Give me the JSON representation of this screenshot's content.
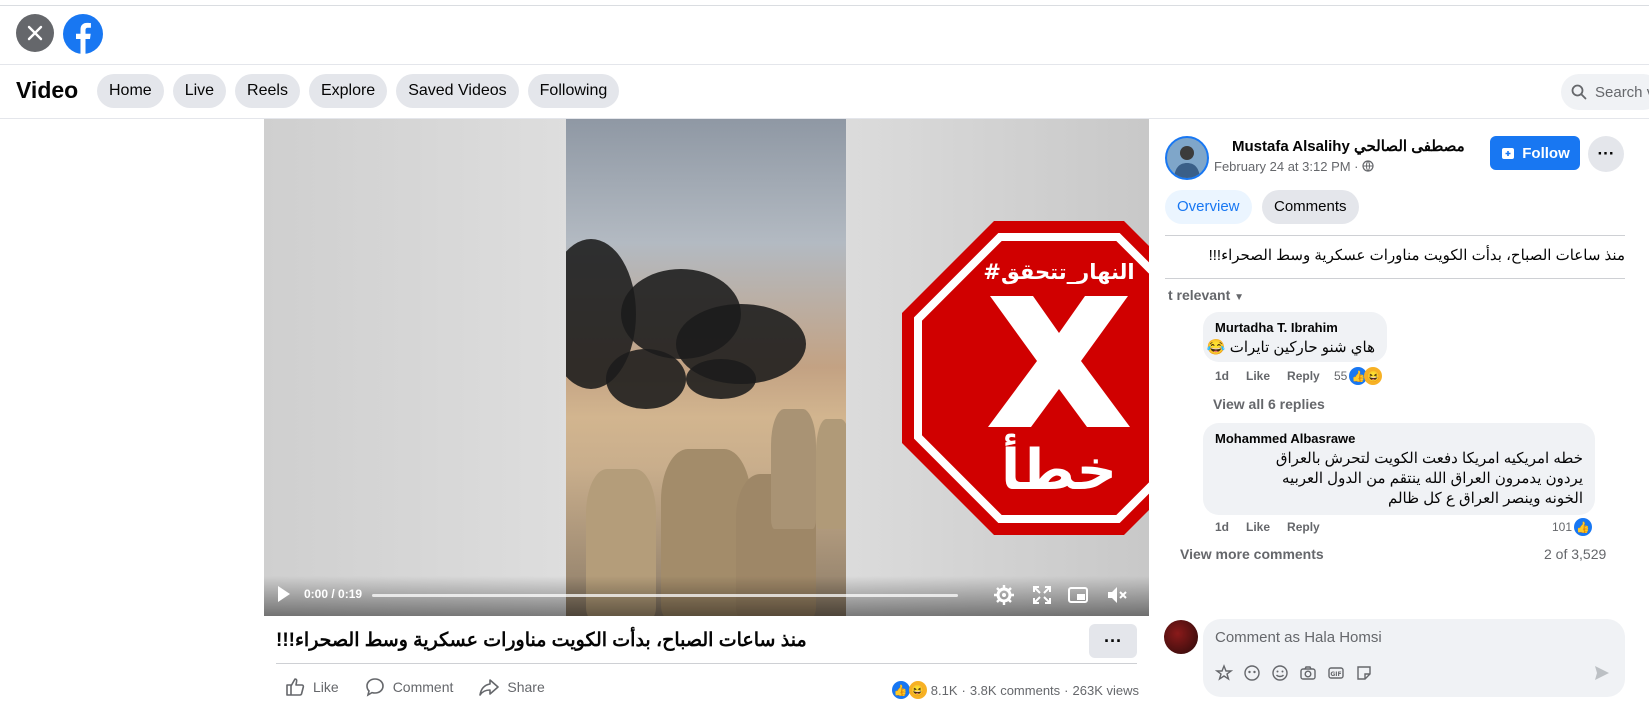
{
  "top": {
    "close_icon": "close-icon",
    "logo_icon": "facebook-logo-icon"
  },
  "header": {
    "title": "Video",
    "nav": [
      "Home",
      "Live",
      "Reels",
      "Explore",
      "Saved Videos",
      "Following"
    ],
    "search_placeholder": "Search v"
  },
  "player": {
    "time": "0:00 / 0:19",
    "progress": 0,
    "badge_hashtag": "#النهار_تتحقق",
    "badge_verdict": "خطأ",
    "badge_color": "#d00000"
  },
  "video": {
    "caption": "منذ ساعات الصباح، بدأت الكويت مناورات عسكرية وسط الصحراء!!!",
    "more": "···",
    "actions": {
      "like": "Like",
      "comment": "Comment",
      "share": "Share"
    },
    "stats": {
      "reactions": "8.1K",
      "comments": "3.8K comments",
      "views": "263K views",
      "sep": "·"
    }
  },
  "post": {
    "author": "Mustafa Alsalihy مصطفى الصالحي",
    "date": "February 24 at 3:12 PM ·",
    "follow": "Follow",
    "more": "···",
    "tabs": {
      "overview": "Overview",
      "comments": "Comments"
    },
    "body": "منذ ساعات الصباح، بدأت الكويت مناورات عسكرية وسط الصحراء!!!",
    "sort": "t relevant",
    "accent": "#1877f2"
  },
  "comments": [
    {
      "name": "Murtadha T. Ibrahim",
      "text": "هاي شنو حاركين تايرات 😂",
      "age": "1d",
      "like": "Like",
      "reply": "Reply",
      "count": "55"
    },
    {
      "name": "Mohammed Albasrawe",
      "text": "خطه امريكيه امريكا دفعت الكويت لتحرش بالعراق يردون يدمرون العراق الله ينتقم من الدول العربيه الخونه وينصر العراق ع كل ظالم",
      "age": "1d",
      "like": "Like",
      "reply": "Reply",
      "count": "101"
    }
  ],
  "thread": {
    "view_replies": "View all 6 replies",
    "view_more": "View more comments",
    "page_count": "2 of 3,529",
    "composer_placeholder": "Comment as Hala Homsi"
  }
}
